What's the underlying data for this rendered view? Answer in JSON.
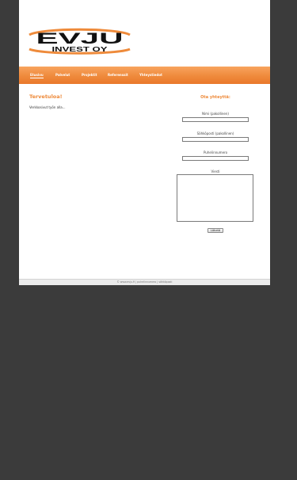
{
  "brand": {
    "logo_text_main": "EVJU",
    "logo_text_sub": "INVEST OY",
    "accent_color": "#ee8a3a"
  },
  "nav": {
    "items": [
      {
        "label": "Etusivu"
      },
      {
        "label": "Palvelut"
      },
      {
        "label": "Projektit"
      },
      {
        "label": "Referenssit"
      },
      {
        "label": "Yhteystiedot"
      }
    ]
  },
  "main": {
    "welcome_title": "Tervetuloa!",
    "welcome_text": "Verkkosivut työn alla..."
  },
  "contact_form": {
    "title": "Ota yhteyttä:",
    "name_label": "Nimi (pakollinen)",
    "email_label": "Sähköposti (pakollinen)",
    "phone_label": "Puhelinnumero",
    "message_label": "Viesti",
    "submit_label": "Lähetä"
  },
  "footer": {
    "text": "© www.evju.fi | puhelinnumero | sähköposti"
  }
}
